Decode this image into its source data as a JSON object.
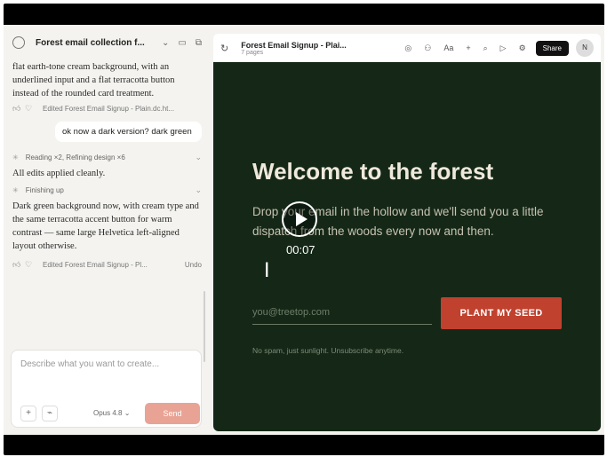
{
  "chat": {
    "title": "Forest email collection f...",
    "messages": [
      "flat earth-tone cream background, with an underlined input and a flat terracotta button instead of the rounded card treatment.",
      "Dark green background now, with cream type and the same terracotta accent button for warm contrast — same large Helvetica left-aligned layout otherwise."
    ],
    "edit_1": "Edited Forest Email Signup - Plain.dc.ht...",
    "user_message": "ok now a dark version? dark green",
    "status_1": "Reading ×2, Refining design ×6",
    "applied": "All edits applied cleanly.",
    "status_2": "Finishing up",
    "edit_2": "Edited Forest Email Signup - Pl...",
    "undo": "Undo",
    "composer_placeholder": "Describe what you want to create...",
    "model": "Opus 4.8",
    "send": "Send"
  },
  "preview": {
    "title": "Forest Email Signup - Plai...",
    "subtitle": "7 pages",
    "share": "Share",
    "avatar": "N",
    "heading": "Welcome to the forest",
    "lead": "Drop your email in the hollow and we'll send you a little dispatch from the woods every now and then.",
    "email_placeholder": "you@treetop.com",
    "cta": "PLANT MY SEED",
    "fineprint": "No spam, just sunlight. Unsubscribe anytime."
  },
  "video": {
    "timestamp": "00:07"
  },
  "colors": {
    "canvas": "#152817",
    "cta": "#c0412e",
    "cream": "#efe9dc"
  },
  "icons": [
    "logo-icon",
    "sidebar-icon",
    "copy-icon",
    "thumbs-up-icon",
    "thumbs-down-icon",
    "back-icon",
    "comment-icon",
    "people-icon",
    "text-icon",
    "plus-icon",
    "search-icon",
    "play-icon",
    "settings-icon",
    "play-button-icon",
    "text-cursor-icon"
  ]
}
